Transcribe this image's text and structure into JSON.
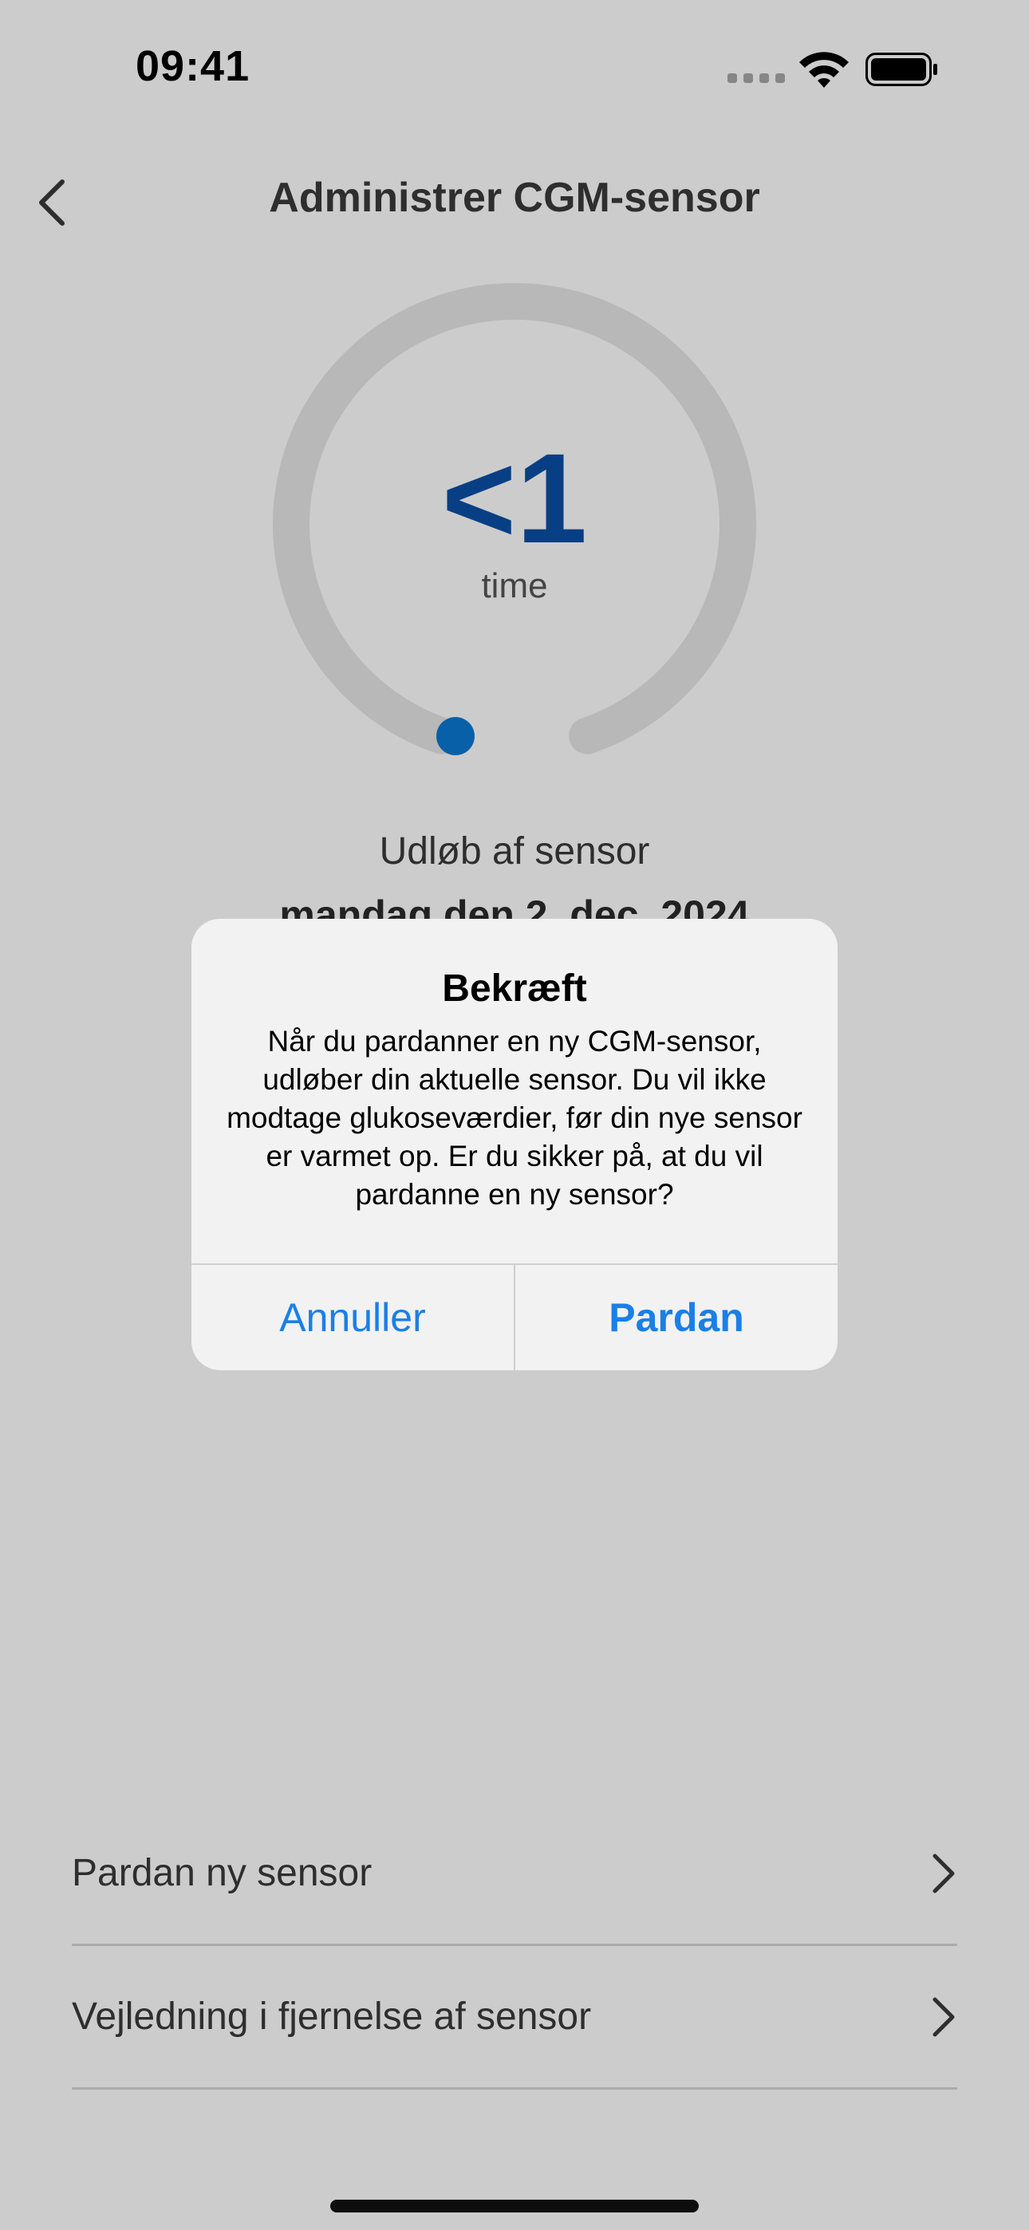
{
  "status_bar": {
    "time": "09:41"
  },
  "nav": {
    "title": "Administrer CGM-sensor"
  },
  "sensor": {
    "remaining_value": "<1",
    "remaining_unit": "time",
    "expiry_label": "Udløb af sensor",
    "expiry_date": "mandag den 2. dec. 2024"
  },
  "list": [
    {
      "label": "Pardan ny sensor"
    },
    {
      "label": "Vejledning i fjernelse af sensor"
    }
  ],
  "alert": {
    "title": "Bekræft",
    "message": "Når du pardanner en ny CGM-sensor, udløber din aktuelle sensor. Du vil ikke modtage glukoseværdier, før din nye sensor er varmet op. Er du sikker på, at du vil pardanne en ny sensor?",
    "cancel_label": "Annuller",
    "confirm_label": "Pardan"
  },
  "colors": {
    "accent": "#1a7fe6",
    "value_blue": "#0b4fa5",
    "ring_track": "#e6e6e6",
    "ring_dot": "#0a78d2"
  },
  "icons": {
    "back": "chevron-left-icon",
    "row_chevron": "chevron-right-icon",
    "wifi": "wifi-icon",
    "battery": "battery-icon"
  }
}
